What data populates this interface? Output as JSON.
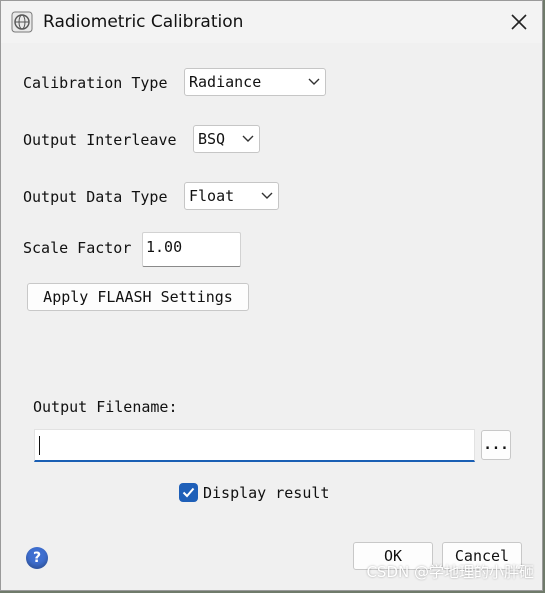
{
  "window": {
    "title": "Radiometric Calibration"
  },
  "form": {
    "calibration_type": {
      "label": "Calibration Type",
      "value": "Radiance"
    },
    "output_interleave": {
      "label": "Output Interleave",
      "value": "BSQ"
    },
    "output_data_type": {
      "label": "Output Data Type",
      "value": "Float"
    },
    "scale_factor": {
      "label": "Scale Factor",
      "value": "1.00"
    },
    "apply_flaash_label": "Apply FLAASH Settings",
    "output_filename": {
      "label": "Output Filename:",
      "value": "",
      "browse_label": "..."
    },
    "display_result": {
      "label": "Display result",
      "checked": true
    }
  },
  "footer": {
    "help_label": "?",
    "ok_label": "OK",
    "cancel_label": "Cancel"
  },
  "watermark": "CSDN @学地理的小胖砸",
  "colors": {
    "accent": "#1e5fb8",
    "dialog_bg": "#f0f0f0"
  }
}
